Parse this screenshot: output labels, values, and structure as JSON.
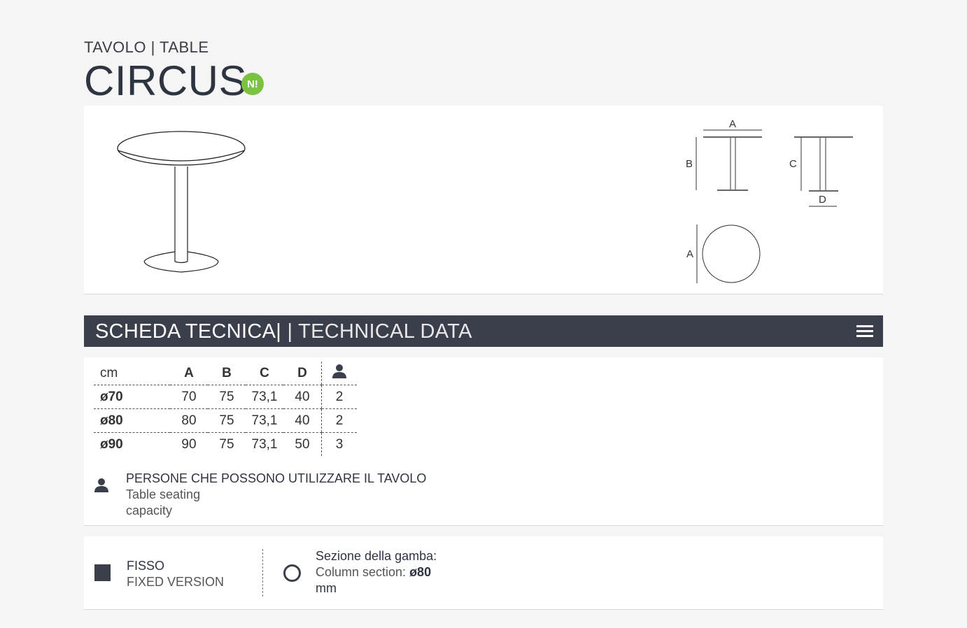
{
  "header": {
    "subtitle_it": "TAVOLO",
    "subtitle_sep": " | ",
    "subtitle_en": "TABLE",
    "title": "CIRCUS",
    "badge": "N!"
  },
  "drawing": {
    "label_a": "A",
    "label_b": "B",
    "label_c": "C",
    "label_d": "D"
  },
  "section": {
    "title_it": "SCHEDA TECNICA|",
    "title_en": " | TECHNICAL DATA"
  },
  "table": {
    "unit": "cm",
    "headers": [
      "A",
      "B",
      "C",
      "D"
    ],
    "rows": [
      {
        "label": "ø70",
        "a": "70",
        "b": "75",
        "c": "73,1",
        "d": "40",
        "p": "2"
      },
      {
        "label": "ø80",
        "a": "80",
        "b": "75",
        "c": "73,1",
        "d": "40",
        "p": "2"
      },
      {
        "label": "ø90",
        "a": "90",
        "b": "75",
        "c": "73,1",
        "d": "50",
        "p": "3"
      }
    ]
  },
  "legend": {
    "line1": "PERSONE CHE POSSONO UTILIZZARE IL TAVOLO",
    "line2": "Table seating",
    "line3": "capacity"
  },
  "options": {
    "fixed_it": "FISSO",
    "fixed_en": "FIXED VERSION",
    "column_it": "Sezione della gamba:",
    "column_en": "Column section: ",
    "column_value": "ø80",
    "column_unit": "mm"
  },
  "colors": {
    "dark": "#3a3f4b",
    "badge": "#7cc242"
  }
}
